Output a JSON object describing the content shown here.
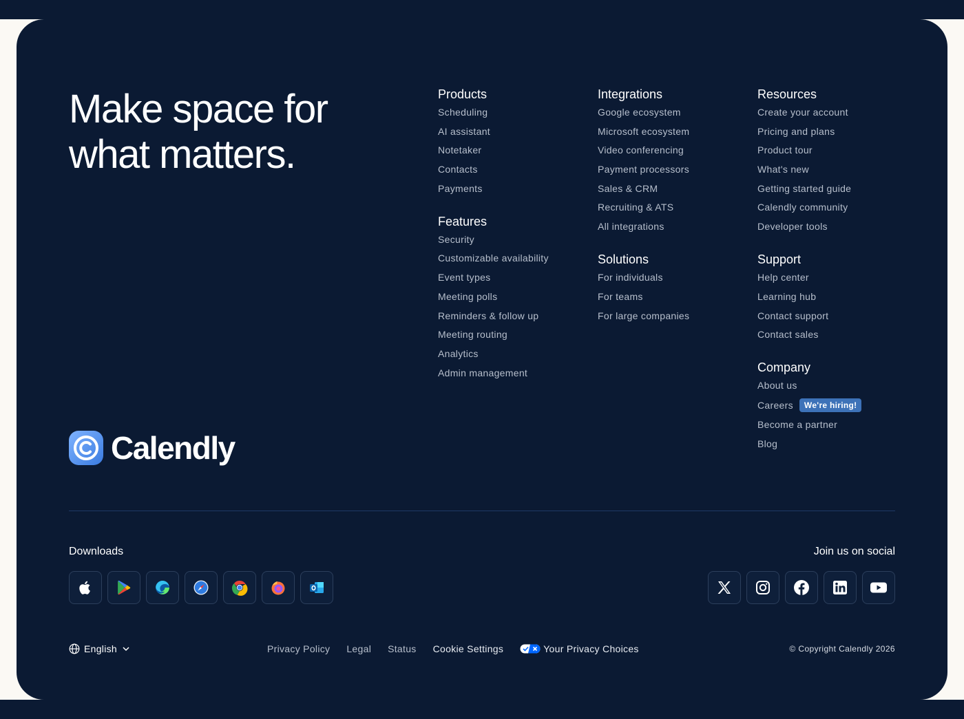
{
  "hero": {
    "line1": "Make space for",
    "line2": "what matters."
  },
  "brand": {
    "name": "Calendly"
  },
  "columns": {
    "products": {
      "title": "Products",
      "items": [
        "Scheduling",
        "AI assistant",
        "Notetaker",
        "Contacts",
        "Payments"
      ]
    },
    "features": {
      "title": "Features",
      "items": [
        "Security",
        "Customizable availability",
        "Event types",
        "Meeting polls",
        "Reminders & follow up",
        "Meeting routing",
        "Analytics",
        "Admin management"
      ]
    },
    "integrations": {
      "title": "Integrations",
      "items": [
        "Google ecosystem",
        "Microsoft ecosystem",
        "Video conferencing",
        "Payment processors",
        "Sales & CRM",
        "Recruiting & ATS",
        "All integrations"
      ]
    },
    "solutions": {
      "title": "Solutions",
      "items": [
        "For individuals",
        "For teams",
        "For large companies"
      ]
    },
    "resources": {
      "title": "Resources",
      "items": [
        "Create your account",
        "Pricing and plans",
        "Product tour",
        "What's new",
        "Getting started guide",
        "Calendly community",
        "Developer tools"
      ]
    },
    "support": {
      "title": "Support",
      "items": [
        "Help center",
        "Learning hub",
        "Contact support",
        "Contact sales"
      ]
    },
    "company": {
      "title": "Company",
      "about": "About us",
      "careers": "Careers",
      "hiring_badge": "We're hiring!",
      "partner": "Become a partner",
      "blog": "Blog"
    }
  },
  "downloads": {
    "title": "Downloads",
    "icons": [
      "apple-icon",
      "google-play-icon",
      "edge-icon",
      "safari-icon",
      "chrome-icon",
      "firefox-icon",
      "outlook-icon"
    ]
  },
  "social": {
    "title": "Join us on social",
    "icons": [
      "x-icon",
      "instagram-icon",
      "facebook-icon",
      "linkedin-icon",
      "youtube-icon"
    ]
  },
  "footer": {
    "language": "English",
    "privacy_policy": "Privacy Policy",
    "legal": "Legal",
    "status": "Status",
    "cookie_settings": "Cookie Settings",
    "privacy_choices": "Your Privacy Choices",
    "copyright": "© Copyright Calendly 2026"
  },
  "colors": {
    "background": "#0b1a33",
    "cream": "#fbf9f4",
    "brand_blue": "#3d72b8",
    "link": "#b7bfcc"
  }
}
